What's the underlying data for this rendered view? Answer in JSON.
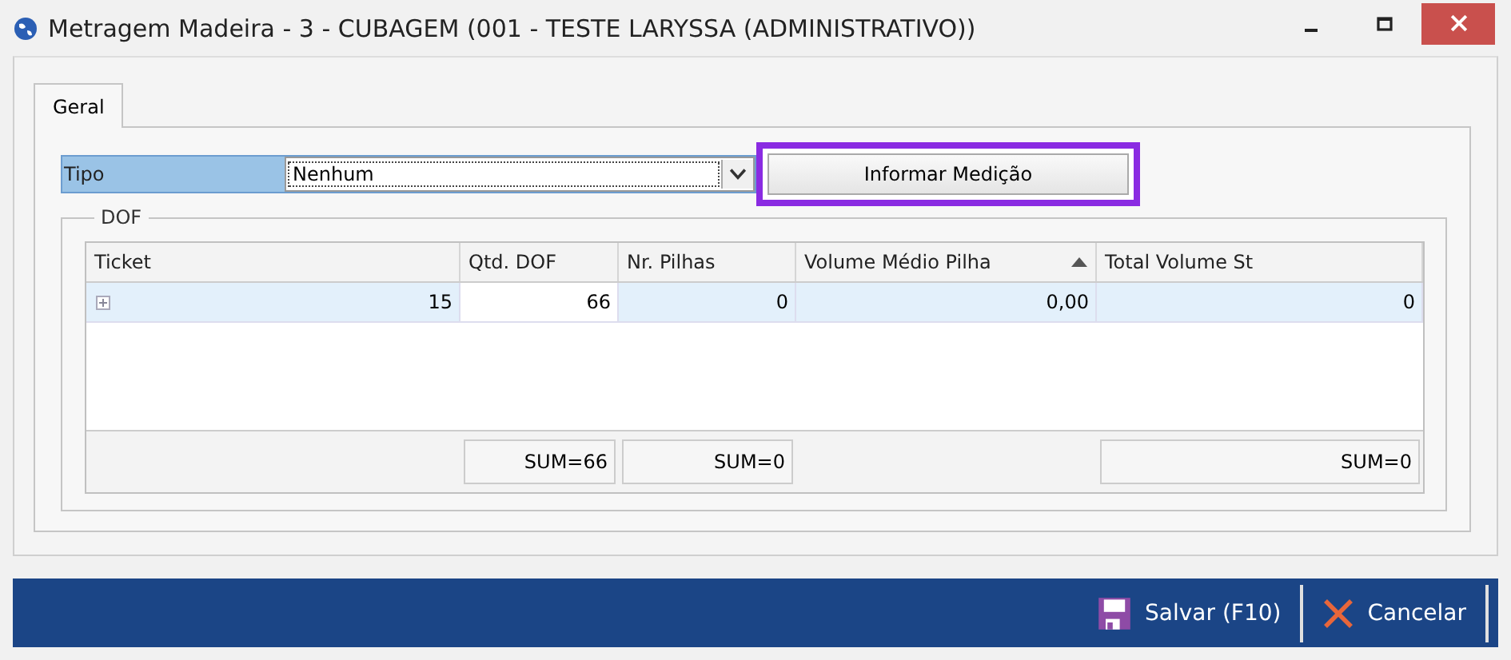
{
  "window": {
    "title": "Metragem Madeira - 3 - CUBAGEM (001 - TESTE LARYSSA (ADMINISTRATIVO))"
  },
  "tabs": [
    {
      "label": "Geral",
      "selected": true
    }
  ],
  "tipo": {
    "label": "Tipo",
    "value": "Nenhum"
  },
  "measure_button": {
    "label": "Informar Medição",
    "highlighted": true
  },
  "dof": {
    "title": "DOF",
    "columns": [
      {
        "label": "Ticket"
      },
      {
        "label": "Qtd. DOF"
      },
      {
        "label": "Nr. Pilhas"
      },
      {
        "label": "Volume Médio Pilha",
        "sorted_ascending": true
      },
      {
        "label": "Total Volume St"
      }
    ],
    "rows": [
      {
        "selected": true,
        "expandable": true,
        "cells": [
          {
            "text": "15",
            "focused": false
          },
          {
            "text": "66",
            "focused": true
          },
          {
            "text": "0",
            "focused": false
          },
          {
            "text": "0,00",
            "focused": false
          },
          {
            "text": "0",
            "focused": false
          }
        ]
      }
    ],
    "summary_row": {
      "qtd_dof": "SUM=66",
      "nr_pilhas": "SUM=0",
      "total_volume_st": "SUM=0"
    }
  },
  "buttons": [
    {
      "kind": "save",
      "label": "Salvar (F10)"
    },
    {
      "kind": "cancel",
      "label": "Cancelar"
    }
  ]
}
